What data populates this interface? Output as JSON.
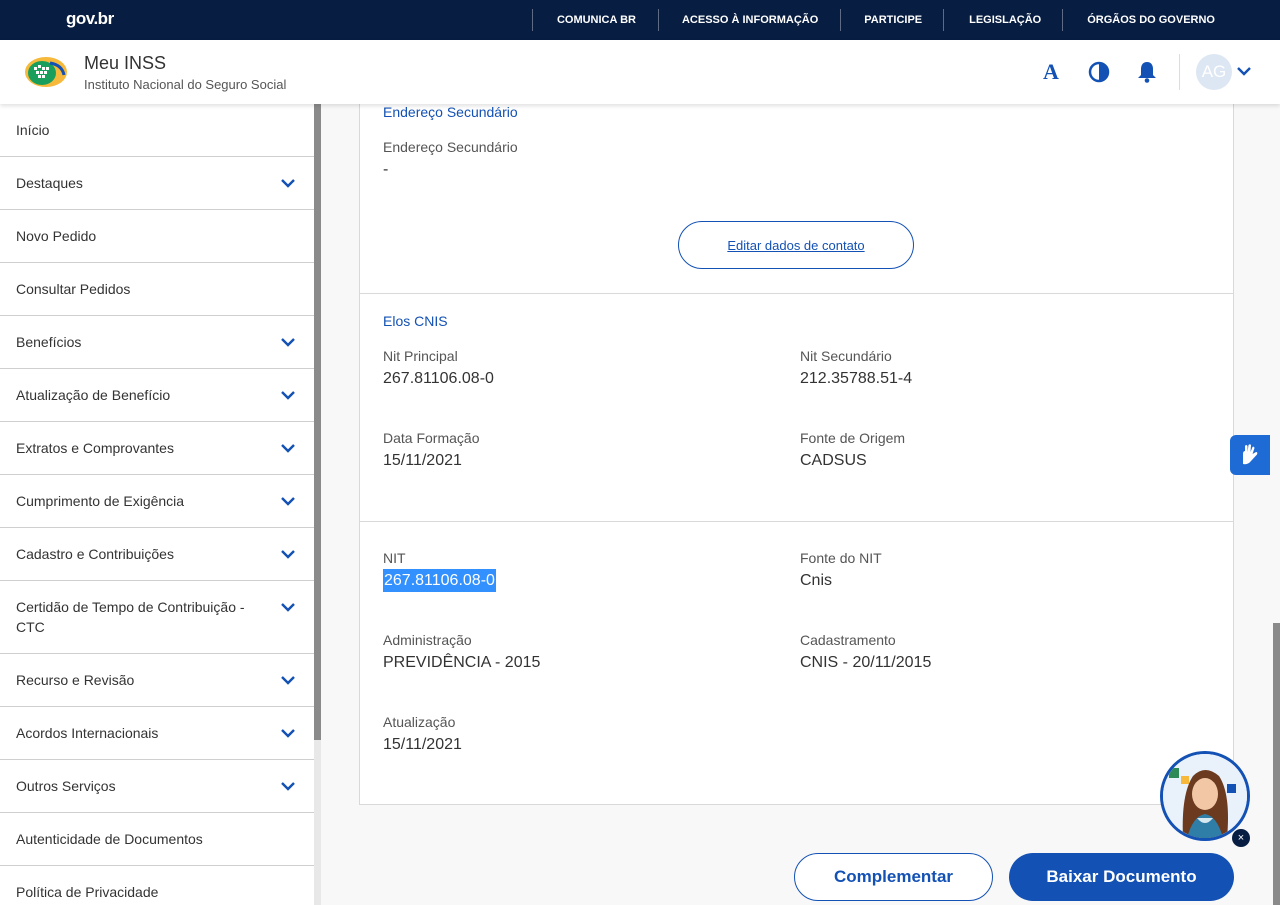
{
  "govbar": {
    "logo": "gov.br",
    "nav": [
      "COMUNICA BR",
      "ACESSO À INFORMAÇÃO",
      "PARTICIPE",
      "LEGISLAÇÃO",
      "ÓRGÃOS DO GOVERNO"
    ]
  },
  "header": {
    "title": "Meu INSS",
    "subtitle": "Instituto Nacional do Seguro Social",
    "font_icon_glyph": "A",
    "avatar_initials": "AG"
  },
  "sidebar": {
    "items": [
      {
        "label": "Início"
      },
      {
        "label": "Destaques"
      },
      {
        "label": "Novo Pedido"
      },
      {
        "label": "Consultar Pedidos"
      },
      {
        "label": "Benefícios"
      },
      {
        "label": "Atualização de Benefício"
      },
      {
        "label": "Extratos e Comprovantes"
      },
      {
        "label": "Cumprimento de Exigência"
      },
      {
        "label": "Cadastro e Contribuições"
      },
      {
        "label": "Certidão de Tempo de Contribuição - CTC"
      },
      {
        "label": "Recurso e Revisão"
      },
      {
        "label": "Acordos Internacionais"
      },
      {
        "label": "Outros Serviços"
      },
      {
        "label": "Autenticidade de Documentos"
      },
      {
        "label": "Política de Privacidade"
      }
    ]
  },
  "secondary_address": {
    "section_title": "Endereço Secundário",
    "field_label": "Endereço Secundário",
    "field_value": "-",
    "edit_button": "Editar dados de contato"
  },
  "elos_cnis": {
    "section_title": "Elos CNIS",
    "nit_principal_label": "Nit Principal",
    "nit_principal_value": "267.81106.08-0",
    "nit_secundario_label": "Nit Secundário",
    "nit_secundario_value": "212.35788.51-4",
    "data_formacao_label": "Data Formação",
    "data_formacao_value": "15/11/2021",
    "fonte_origem_label": "Fonte de Origem",
    "fonte_origem_value": "CADSUS"
  },
  "nit_details": {
    "nit_label": "NIT",
    "nit_value": "267.81106.08-0",
    "fonte_label": "Fonte do NIT",
    "fonte_value": "Cnis",
    "administracao_label": "Administração",
    "administracao_value": "PREVIDÊNCIA - 2015",
    "cadastramento_label": "Cadastramento",
    "cadastramento_value": "CNIS - 20/11/2015",
    "atualizacao_label": "Atualização",
    "atualizacao_value": "15/11/2021"
  },
  "actions": {
    "complementar": "Complementar",
    "baixar": "Baixar Documento"
  },
  "assistant": {
    "close_glyph": "×"
  },
  "colors": {
    "govbar_bg": "#071d41",
    "primary": "#1351b4",
    "selection": "#3390ff"
  }
}
